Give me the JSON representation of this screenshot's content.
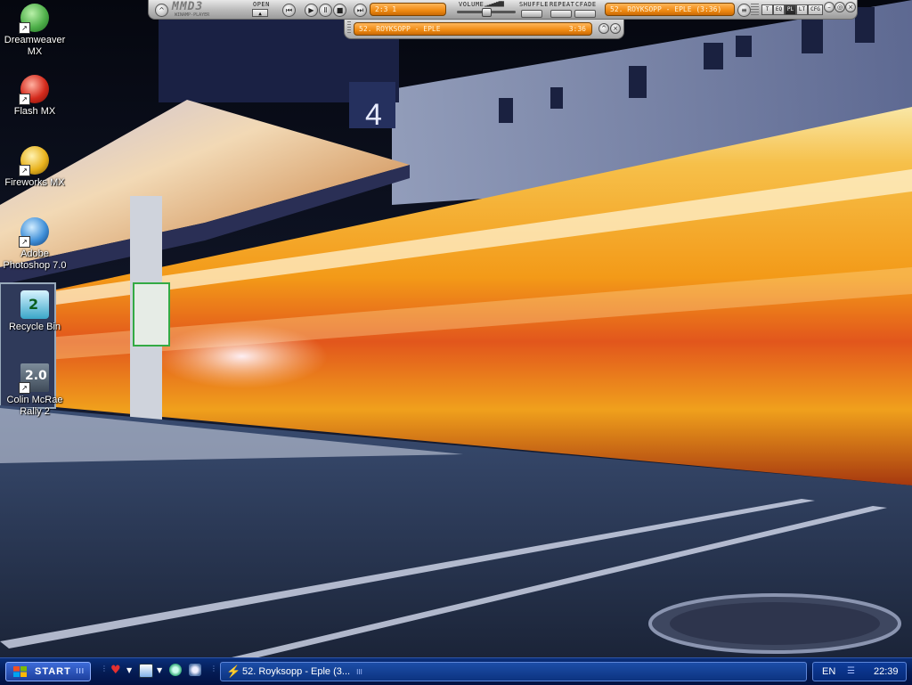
{
  "desktop": {
    "icons": [
      {
        "label_line1": "Dreamweaver",
        "label_line2": "MX",
        "icon": "dreamweaver-icon",
        "color": "#4fb04a"
      },
      {
        "label_line1": "Flash MX",
        "label_line2": "",
        "icon": "flash-icon",
        "color": "#d42a1c"
      },
      {
        "label_line1": "Fireworks MX",
        "label_line2": "",
        "icon": "fireworks-icon",
        "color": "#e8b21d"
      },
      {
        "label_line1": "Adobe",
        "label_line2": "Photoshop 7.0",
        "icon": "photoshop-icon",
        "color": "#3f8fd8"
      },
      {
        "label_line1": "Recycle Bin",
        "label_line2": "",
        "icon": "recycle-bin-icon",
        "color": "#3aa6c8"
      },
      {
        "label_line1": "Colin McRae",
        "label_line2": "Rally 2",
        "icon": "colin-mcrae-icon",
        "color": "#8a9aa8"
      }
    ],
    "recycle_badge": "2",
    "colin_badge": "2.0"
  },
  "winamp": {
    "logo": "MMD3",
    "subtitle": "WINAMP-PLAYER",
    "open_label": "OPEN",
    "volume_label": "VOLUME",
    "shuffle_label": "SHUFFLE",
    "repeat_label": "REPEAT",
    "cfade_label": "CFADE",
    "time_display": "2:3 1",
    "track_title": "52. ROYKSOPP - EPLE (3:36)",
    "mode_buttons": [
      "T",
      "EQ",
      "PL",
      "LT",
      "CFG"
    ],
    "accent_color": "#f08a12",
    "playlist": {
      "track": "52. ROYKSOPP - EPLE",
      "duration": "3:36"
    }
  },
  "taskbar": {
    "start_label": "START",
    "winamp_task_label": "52. Royksopp - Eple (3...",
    "language": "EN",
    "clock": "22:39"
  }
}
